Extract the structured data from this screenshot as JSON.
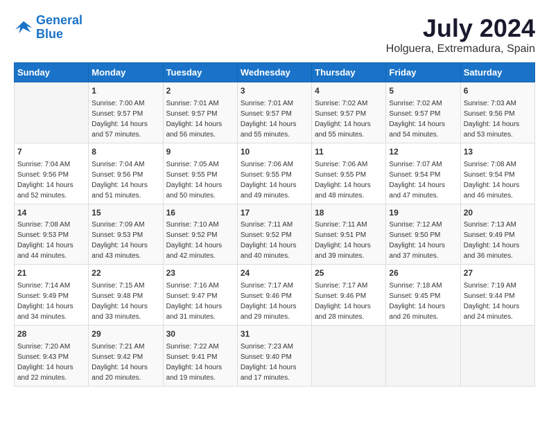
{
  "logo": {
    "line1": "General",
    "line2": "Blue"
  },
  "title": "July 2024",
  "location": "Holguera, Extremadura, Spain",
  "days_of_week": [
    "Sunday",
    "Monday",
    "Tuesday",
    "Wednesday",
    "Thursday",
    "Friday",
    "Saturday"
  ],
  "weeks": [
    [
      {
        "day": "",
        "sunrise": "",
        "sunset": "",
        "daylight": ""
      },
      {
        "day": "1",
        "sunrise": "Sunrise: 7:00 AM",
        "sunset": "Sunset: 9:57 PM",
        "daylight": "Daylight: 14 hours and 57 minutes."
      },
      {
        "day": "2",
        "sunrise": "Sunrise: 7:01 AM",
        "sunset": "Sunset: 9:57 PM",
        "daylight": "Daylight: 14 hours and 56 minutes."
      },
      {
        "day": "3",
        "sunrise": "Sunrise: 7:01 AM",
        "sunset": "Sunset: 9:57 PM",
        "daylight": "Daylight: 14 hours and 55 minutes."
      },
      {
        "day": "4",
        "sunrise": "Sunrise: 7:02 AM",
        "sunset": "Sunset: 9:57 PM",
        "daylight": "Daylight: 14 hours and 55 minutes."
      },
      {
        "day": "5",
        "sunrise": "Sunrise: 7:02 AM",
        "sunset": "Sunset: 9:57 PM",
        "daylight": "Daylight: 14 hours and 54 minutes."
      },
      {
        "day": "6",
        "sunrise": "Sunrise: 7:03 AM",
        "sunset": "Sunset: 9:56 PM",
        "daylight": "Daylight: 14 hours and 53 minutes."
      }
    ],
    [
      {
        "day": "7",
        "sunrise": "Sunrise: 7:04 AM",
        "sunset": "Sunset: 9:56 PM",
        "daylight": "Daylight: 14 hours and 52 minutes."
      },
      {
        "day": "8",
        "sunrise": "Sunrise: 7:04 AM",
        "sunset": "Sunset: 9:56 PM",
        "daylight": "Daylight: 14 hours and 51 minutes."
      },
      {
        "day": "9",
        "sunrise": "Sunrise: 7:05 AM",
        "sunset": "Sunset: 9:55 PM",
        "daylight": "Daylight: 14 hours and 50 minutes."
      },
      {
        "day": "10",
        "sunrise": "Sunrise: 7:06 AM",
        "sunset": "Sunset: 9:55 PM",
        "daylight": "Daylight: 14 hours and 49 minutes."
      },
      {
        "day": "11",
        "sunrise": "Sunrise: 7:06 AM",
        "sunset": "Sunset: 9:55 PM",
        "daylight": "Daylight: 14 hours and 48 minutes."
      },
      {
        "day": "12",
        "sunrise": "Sunrise: 7:07 AM",
        "sunset": "Sunset: 9:54 PM",
        "daylight": "Daylight: 14 hours and 47 minutes."
      },
      {
        "day": "13",
        "sunrise": "Sunrise: 7:08 AM",
        "sunset": "Sunset: 9:54 PM",
        "daylight": "Daylight: 14 hours and 46 minutes."
      }
    ],
    [
      {
        "day": "14",
        "sunrise": "Sunrise: 7:08 AM",
        "sunset": "Sunset: 9:53 PM",
        "daylight": "Daylight: 14 hours and 44 minutes."
      },
      {
        "day": "15",
        "sunrise": "Sunrise: 7:09 AM",
        "sunset": "Sunset: 9:53 PM",
        "daylight": "Daylight: 14 hours and 43 minutes."
      },
      {
        "day": "16",
        "sunrise": "Sunrise: 7:10 AM",
        "sunset": "Sunset: 9:52 PM",
        "daylight": "Daylight: 14 hours and 42 minutes."
      },
      {
        "day": "17",
        "sunrise": "Sunrise: 7:11 AM",
        "sunset": "Sunset: 9:52 PM",
        "daylight": "Daylight: 14 hours and 40 minutes."
      },
      {
        "day": "18",
        "sunrise": "Sunrise: 7:11 AM",
        "sunset": "Sunset: 9:51 PM",
        "daylight": "Daylight: 14 hours and 39 minutes."
      },
      {
        "day": "19",
        "sunrise": "Sunrise: 7:12 AM",
        "sunset": "Sunset: 9:50 PM",
        "daylight": "Daylight: 14 hours and 37 minutes."
      },
      {
        "day": "20",
        "sunrise": "Sunrise: 7:13 AM",
        "sunset": "Sunset: 9:49 PM",
        "daylight": "Daylight: 14 hours and 36 minutes."
      }
    ],
    [
      {
        "day": "21",
        "sunrise": "Sunrise: 7:14 AM",
        "sunset": "Sunset: 9:49 PM",
        "daylight": "Daylight: 14 hours and 34 minutes."
      },
      {
        "day": "22",
        "sunrise": "Sunrise: 7:15 AM",
        "sunset": "Sunset: 9:48 PM",
        "daylight": "Daylight: 14 hours and 33 minutes."
      },
      {
        "day": "23",
        "sunrise": "Sunrise: 7:16 AM",
        "sunset": "Sunset: 9:47 PM",
        "daylight": "Daylight: 14 hours and 31 minutes."
      },
      {
        "day": "24",
        "sunrise": "Sunrise: 7:17 AM",
        "sunset": "Sunset: 9:46 PM",
        "daylight": "Daylight: 14 hours and 29 minutes."
      },
      {
        "day": "25",
        "sunrise": "Sunrise: 7:17 AM",
        "sunset": "Sunset: 9:46 PM",
        "daylight": "Daylight: 14 hours and 28 minutes."
      },
      {
        "day": "26",
        "sunrise": "Sunrise: 7:18 AM",
        "sunset": "Sunset: 9:45 PM",
        "daylight": "Daylight: 14 hours and 26 minutes."
      },
      {
        "day": "27",
        "sunrise": "Sunrise: 7:19 AM",
        "sunset": "Sunset: 9:44 PM",
        "daylight": "Daylight: 14 hours and 24 minutes."
      }
    ],
    [
      {
        "day": "28",
        "sunrise": "Sunrise: 7:20 AM",
        "sunset": "Sunset: 9:43 PM",
        "daylight": "Daylight: 14 hours and 22 minutes."
      },
      {
        "day": "29",
        "sunrise": "Sunrise: 7:21 AM",
        "sunset": "Sunset: 9:42 PM",
        "daylight": "Daylight: 14 hours and 20 minutes."
      },
      {
        "day": "30",
        "sunrise": "Sunrise: 7:22 AM",
        "sunset": "Sunset: 9:41 PM",
        "daylight": "Daylight: 14 hours and 19 minutes."
      },
      {
        "day": "31",
        "sunrise": "Sunrise: 7:23 AM",
        "sunset": "Sunset: 9:40 PM",
        "daylight": "Daylight: 14 hours and 17 minutes."
      },
      {
        "day": "",
        "sunrise": "",
        "sunset": "",
        "daylight": ""
      },
      {
        "day": "",
        "sunrise": "",
        "sunset": "",
        "daylight": ""
      },
      {
        "day": "",
        "sunrise": "",
        "sunset": "",
        "daylight": ""
      }
    ]
  ]
}
